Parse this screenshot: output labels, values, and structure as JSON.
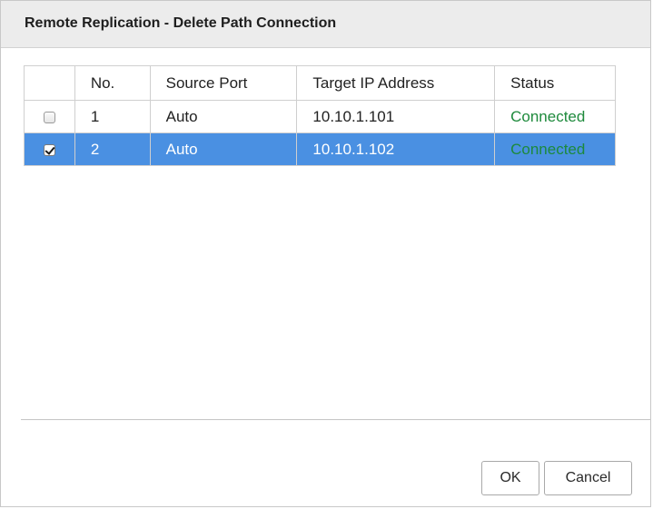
{
  "dialog": {
    "title": "Remote Replication - Delete Path Connection"
  },
  "table": {
    "columns": [
      "",
      "No.",
      "Source Port",
      "Target IP Address",
      "Status"
    ],
    "rows": [
      {
        "checked": false,
        "no": "1",
        "source_port": "Auto",
        "target_ip": "10.10.1.101",
        "status": "Connected",
        "selected": false
      },
      {
        "checked": true,
        "no": "2",
        "source_port": "Auto",
        "target_ip": "10.10.1.102",
        "status": "Connected",
        "selected": true
      }
    ]
  },
  "buttons": {
    "ok_label": "OK",
    "cancel_label": "Cancel"
  },
  "colors": {
    "selected_row": "#4a90e2",
    "status_connected": "#1e8a3c",
    "titlebar": "#ececec"
  }
}
